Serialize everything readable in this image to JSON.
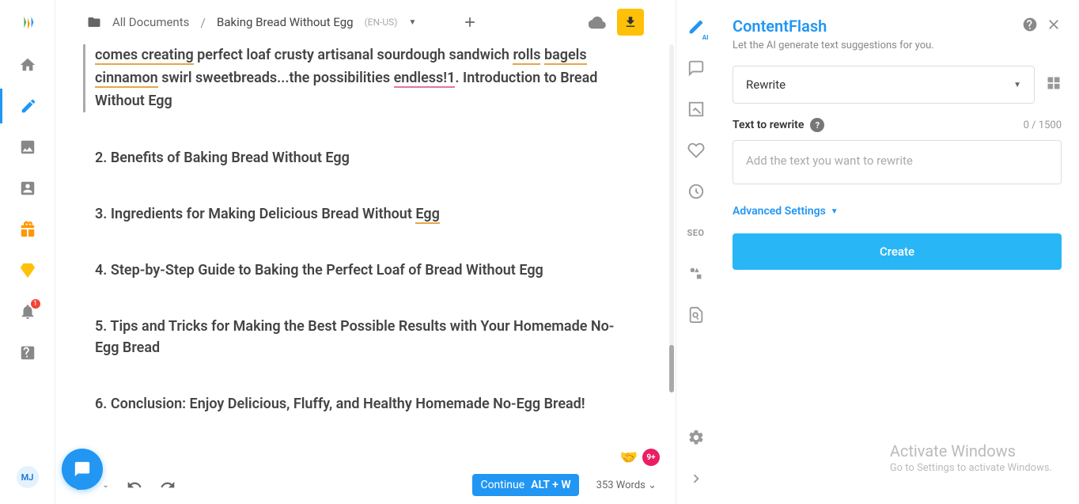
{
  "leftbar": {
    "avatar": "MJ",
    "notif_badge": "1"
  },
  "topbar": {
    "all_docs": "All Documents",
    "sep": "/",
    "title": "Baking Bread Without Egg",
    "lang": "(EN-US)"
  },
  "doc": {
    "intro_pre": "comes creating",
    "intro_mid": " perfect loaf crusty artisanal sourdough sandwich ",
    "intro_rolls": "rolls",
    "intro_bagels": "bagels",
    "intro_cinnamon": "cinnamon",
    "intro_swirl": " swirl sweetbreads...the possibilities ",
    "intro_endless": "endless!1",
    "intro_end": ". Introduction to Bread Without Egg",
    "h2": "2. Benefits of Baking Bread Without Egg",
    "h3a": "3. Ingredients for Making Delicious Bread Without ",
    "h3b": "Egg",
    "h4": "4. Step-by-Step Guide to Baking the Perfect Loaf of Bread Without Egg",
    "h5": "5. Tips and Tricks for Making the Best Possible Results with Your Homemade No-Egg Bread",
    "h6": "6. Conclusion: Enjoy Delicious, Fluffy, and Healthy Homemade No-Egg Bread!"
  },
  "bottombar": {
    "continue": "Continue",
    "kbd": "ALT + W",
    "words": "353 Words"
  },
  "emoji2": "9+",
  "rail": {
    "seo": "SEO",
    "ai_sub": "AI"
  },
  "panel": {
    "title": "ContentFlash",
    "sub": "Let the AI generate text suggestions for you.",
    "select": "Rewrite",
    "label": "Text to rewrite",
    "count": "0 / 1500",
    "placeholder": "Add the text you want to rewrite",
    "adv": "Advanced Settings",
    "create": "Create"
  },
  "watermark": {
    "l1": "Activate Windows",
    "l2": "Go to Settings to activate Windows."
  }
}
